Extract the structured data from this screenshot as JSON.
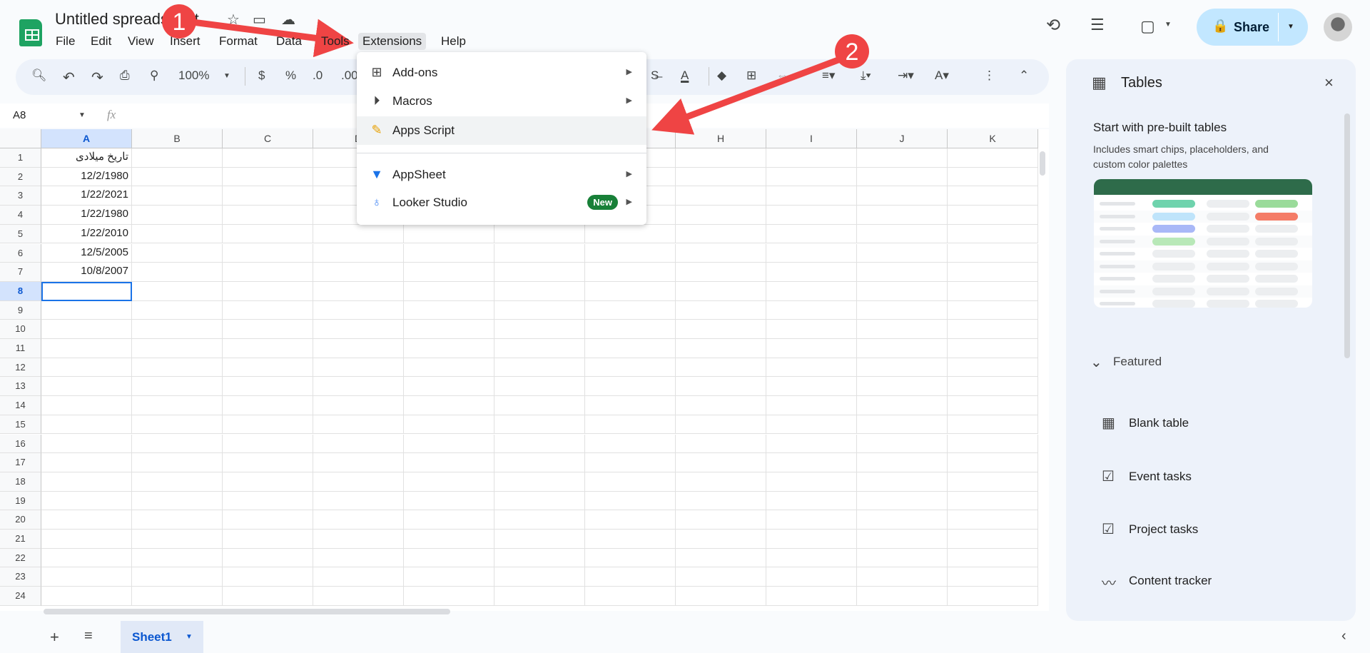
{
  "header": {
    "title": "Untitled spreadsheet",
    "menus": [
      "File",
      "Edit",
      "View",
      "Insert",
      "Format",
      "Data",
      "Tools",
      "Extensions",
      "Help"
    ],
    "active_menu": "Extensions",
    "share_label": "Share"
  },
  "toolbar": {
    "zoom": "100%",
    "currency": "$",
    "percent": "%",
    "dec_decrease": ".0",
    "dec_increase": ".00"
  },
  "formula_bar": {
    "cell_ref": "A8",
    "fx": "fx",
    "value": ""
  },
  "sheet": {
    "columns": [
      "A",
      "B",
      "C",
      "D",
      "E",
      "F",
      "G",
      "H",
      "I",
      "J",
      "K"
    ],
    "selected_column": "A",
    "selected_row": 8,
    "row_count": 24,
    "cells": {
      "A1": "تاریخ میلادی",
      "A2": "12/2/1980",
      "A3": "1/22/2021",
      "A4": "1/22/1980",
      "A5": "1/22/2010",
      "A6": "12/5/2005",
      "A7": "10/8/2007"
    }
  },
  "extensions_menu": {
    "items": [
      {
        "label": "Add-ons",
        "icon": "addons-icon",
        "submenu": true
      },
      {
        "label": "Macros",
        "icon": "play-circle-icon",
        "submenu": true
      },
      {
        "label": "Apps Script",
        "icon": "apps-script-icon",
        "submenu": false,
        "highlighted": true
      },
      {
        "label": "AppSheet",
        "icon": "appsheet-icon",
        "submenu": true
      },
      {
        "label": "Looker Studio",
        "icon": "looker-studio-icon",
        "submenu": true,
        "badge": "New"
      }
    ]
  },
  "annotations": {
    "step1": "1",
    "step2": "2",
    "arrow_color": "#ef4444"
  },
  "tables_panel": {
    "title": "Tables",
    "section_title": "Start with pre-built tables",
    "section_desc_line1": "Includes smart chips, placeholders, and",
    "section_desc_line2": "custom color palettes",
    "featured": "Featured",
    "items": [
      {
        "label": "Blank table",
        "icon": "table-icon"
      },
      {
        "label": "Event tasks",
        "icon": "checklist-icon"
      },
      {
        "label": "Project tasks",
        "icon": "checklist-icon"
      },
      {
        "label": "Content tracker",
        "icon": "trend-icon"
      }
    ]
  },
  "bottom_bar": {
    "sheet_tab": "Sheet1"
  },
  "colors": {
    "accent": "#0b57d0",
    "share_bg": "#c2e7ff",
    "new_badge": "#188038",
    "table_header": "#2e6b4a"
  }
}
